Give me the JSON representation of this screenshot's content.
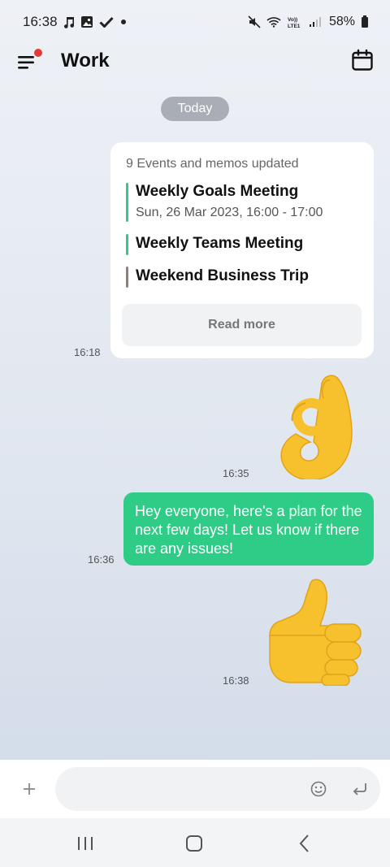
{
  "status_bar": {
    "time": "16:38",
    "battery": "58%",
    "left_icons": [
      "music-note-icon",
      "image-icon",
      "check-icon",
      "dot-icon"
    ],
    "right_icons": [
      "mute-icon",
      "wifi-icon",
      "lte-icon",
      "signal-icon",
      "battery-icon"
    ],
    "lte_label": "Vo)) LTE1"
  },
  "header": {
    "title": "Work",
    "notification_dot_color": "#e53935"
  },
  "chat": {
    "date_label": "Today",
    "event_card": {
      "header": "9 Events and memos updated",
      "events": [
        {
          "title": "Weekly Goals Meeting",
          "subtitle": "Sun, 26 Mar 2023, 16:00  -  17:00",
          "color": "#2ecc87"
        },
        {
          "title": "Weekly Teams Meeting",
          "subtitle": "",
          "color": "#2ecc87"
        },
        {
          "title": "Weekend Business Trip",
          "subtitle": "",
          "color": "#9b7a7a"
        }
      ],
      "read_more": "Read more",
      "time": "16:18"
    },
    "ok_emoji": {
      "emoji": "ok-hand",
      "time": "16:35"
    },
    "message": {
      "text": "Hey everyone, here's a plan for the next few days! Let us know if there are any issues!",
      "time": "16:36",
      "bubble_color": "#2ecc87"
    },
    "thumbs_emoji": {
      "emoji": "thumbs-up",
      "time": "16:38"
    }
  },
  "input": {
    "placeholder": "",
    "value": ""
  },
  "nav": [
    "recent-apps",
    "home",
    "back"
  ]
}
